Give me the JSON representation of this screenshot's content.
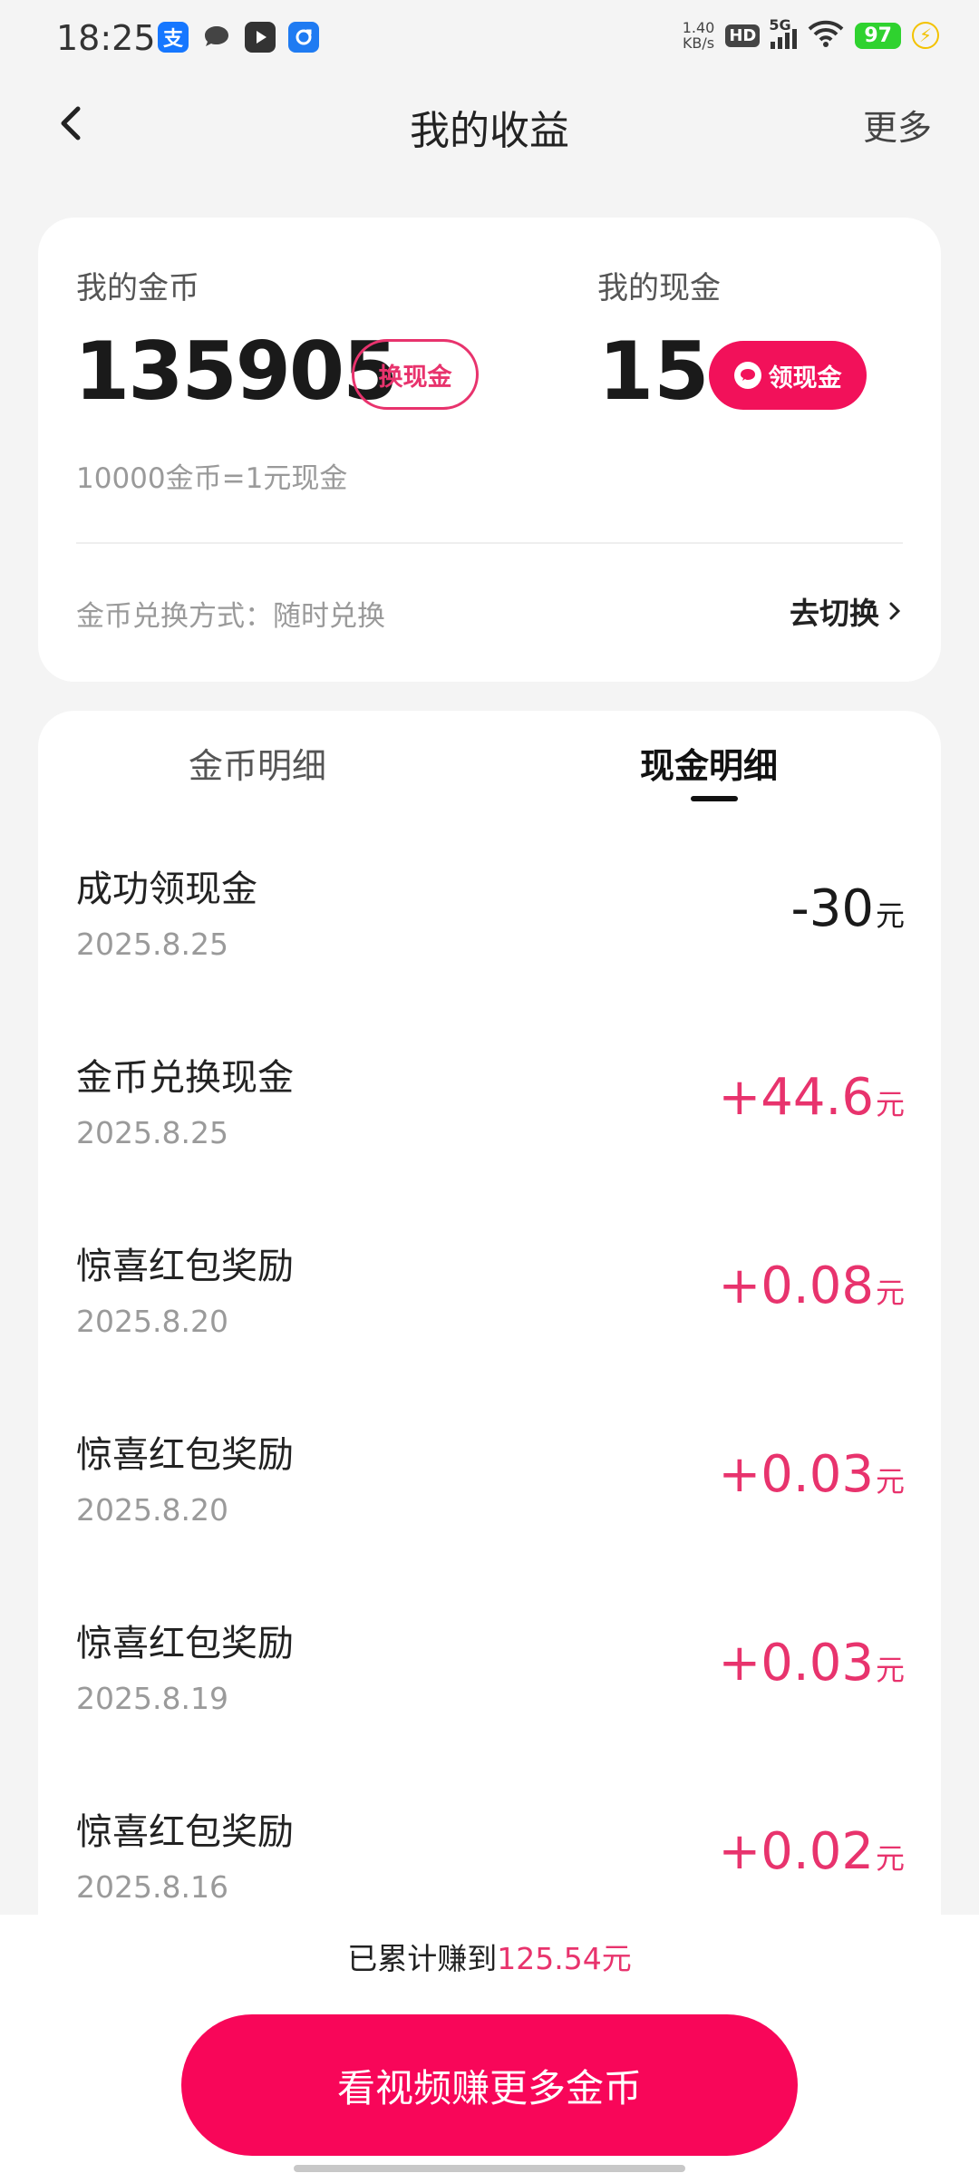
{
  "status_bar": {
    "time": "18:25",
    "net_speed_value": "1.40",
    "net_speed_unit": "KB/s",
    "hd_badge": "HD",
    "signal_label": "5G",
    "battery": "97",
    "app_icons": [
      "alipay-icon",
      "chat-icon",
      "video-icon",
      "share-icon"
    ]
  },
  "header": {
    "title": "我的收益",
    "more_label": "更多"
  },
  "summary": {
    "coin_label": "我的金币",
    "coin_value": "135905",
    "exchange_button": "换现金",
    "cash_label": "我的现金",
    "cash_value": "15",
    "claim_button": "领现金",
    "rate_text": "10000金币=1元现金",
    "method_text": "金币兑换方式：随时兑换",
    "switch_label": "去切换"
  },
  "tabs": {
    "coin_detail": "金币明细",
    "cash_detail": "现金明细",
    "active": "cash_detail"
  },
  "records": [
    {
      "title": "成功领现金",
      "date": "2025.8.25",
      "amount": "-30",
      "unit": "元",
      "type": "out"
    },
    {
      "title": "金币兑换现金",
      "date": "2025.8.25",
      "amount": "+44.6",
      "unit": "元",
      "type": "in"
    },
    {
      "title": "惊喜红包奖励",
      "date": "2025.8.20",
      "amount": "+0.08",
      "unit": "元",
      "type": "in"
    },
    {
      "title": "惊喜红包奖励",
      "date": "2025.8.20",
      "amount": "+0.03",
      "unit": "元",
      "type": "in"
    },
    {
      "title": "惊喜红包奖励",
      "date": "2025.8.19",
      "amount": "+0.03",
      "unit": "元",
      "type": "in"
    },
    {
      "title": "惊喜红包奖励",
      "date": "2025.8.16",
      "amount": "+0.02",
      "unit": "元",
      "type": "in"
    }
  ],
  "bottom": {
    "total_prefix": "已累计赚到",
    "total_value": "125.54元",
    "cta_label": "看视频赚更多金币"
  },
  "colors": {
    "accent": "#e8336d",
    "cta": "#f80659",
    "battery": "#2fd22f"
  }
}
